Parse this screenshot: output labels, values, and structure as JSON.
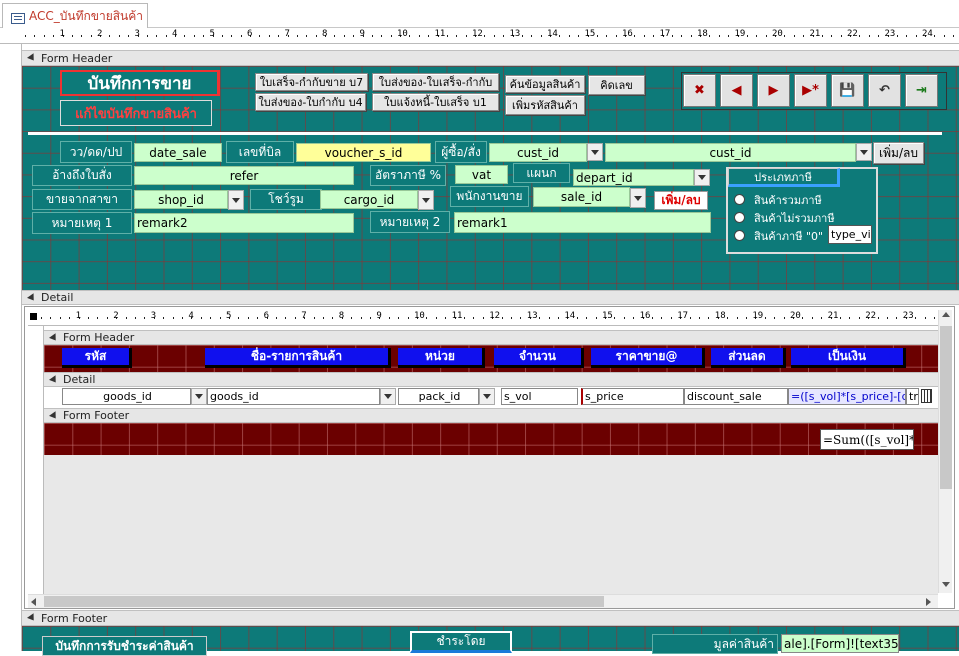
{
  "tab": {
    "title": "ACC_บันทึกขายสินค้า"
  },
  "ruler": {
    "numbers": [
      "1",
      "2",
      "3",
      "4",
      "5",
      "6",
      "7",
      "8",
      "9",
      "10",
      "11",
      "12",
      "13",
      "14",
      "15",
      "16",
      "17",
      "18",
      "19",
      "20",
      "21",
      "22",
      "23",
      "24"
    ],
    "inner_numbers": [
      "1",
      "2",
      "3",
      "4",
      "5",
      "6",
      "7",
      "8",
      "9",
      "10",
      "11",
      "12",
      "13",
      "14",
      "15",
      "16",
      "17",
      "18",
      "19",
      "20",
      "21",
      "22",
      "23"
    ]
  },
  "sections": {
    "form_header": "Form Header",
    "detail": "Detail",
    "form_footer": "Form Footer"
  },
  "header": {
    "title": "บันทึกการขาย",
    "subtitle": "แก้ไขบันทึกขายสินค้า",
    "buttons": {
      "b1": "ใบเสร็จ-กำกับขาย บ7",
      "b2": "ใบส่งของ-ใบเสร็จ-กำกับ",
      "b3": "ค้นข้อมูลสินค้า",
      "b4": "คิดเลข",
      "b5": "ใบส่งของ-ใบกำกับ บ4",
      "b6": "ใบแจ้งหนี้-ใบเสร็จ บ1",
      "b7": "เพิ่มรหัสสินค้า"
    },
    "nav": [
      "✖",
      "◀",
      "▶",
      "▶*",
      "💾",
      "↶",
      "⇥"
    ]
  },
  "form": {
    "date_label": "วว/ดด/ปป",
    "date_value": "date_sale",
    "bill_label": "เลขที่บิล",
    "bill_value": "voucher_s_id",
    "buyer_label": "ผู้ซื้อ/สั่ง",
    "cust1": "cust_id",
    "cust2": "cust_id",
    "add_remove": "เพิ่ม/ลบ",
    "refer_label": "อ้างถึงใบสั่ง",
    "refer_value": "refer",
    "tax_label": "อัตราภาษี %",
    "vat_value": "vat",
    "dept_label": "แผนก",
    "dept_value": "depart_id",
    "branch_label": "ขายจากสาขา",
    "shop_value": "shop_id",
    "showroom_label": "โชว์รูม",
    "cargo_value": "cargo_id",
    "staff_label": "พนักงานขาย",
    "sale_value": "sale_id",
    "add_remove2": "เพิ่ม/ลบ",
    "remark1_label": "หมายเหตุ 1",
    "remark2_value": "remark2",
    "remark2_label": "หมายเหตุ 2",
    "remark1_value": "remark1",
    "tax_group": "ประเภทภาษี",
    "tax_opt1": "สินค้ารวมภาษี",
    "tax_opt2": "สินค้าไม่รวมภาษี",
    "tax_opt3": "สินค้าภาษี \"0\"",
    "type_value": "type_vi"
  },
  "subform": {
    "headers": [
      "รหัส",
      "ชื่อ-รายการสินค้า",
      "หน่วย",
      "จำนวน",
      "ราคาขาย@",
      "ส่วนลด",
      "เป็นเงิน"
    ],
    "goods_id_1": "goods_id",
    "goods_id_2": "goods_id",
    "pack_id": "pack_id",
    "s_vol": "s_vol",
    "s_price": "s_price",
    "discount": "discount_sale",
    "formula": "=([s_vol]*[s_price]-[dis",
    "tr": "tr",
    "sum": "=Sum(([s_vol]*"
  },
  "footer": {
    "payment_label": "บันทึกการรับชำระค่าสินค้า",
    "paid_by": "ชำระโดย",
    "goods_value_label": "มูลค่าสินค้า",
    "goods_value": "ale].[Form]![text35]"
  }
}
